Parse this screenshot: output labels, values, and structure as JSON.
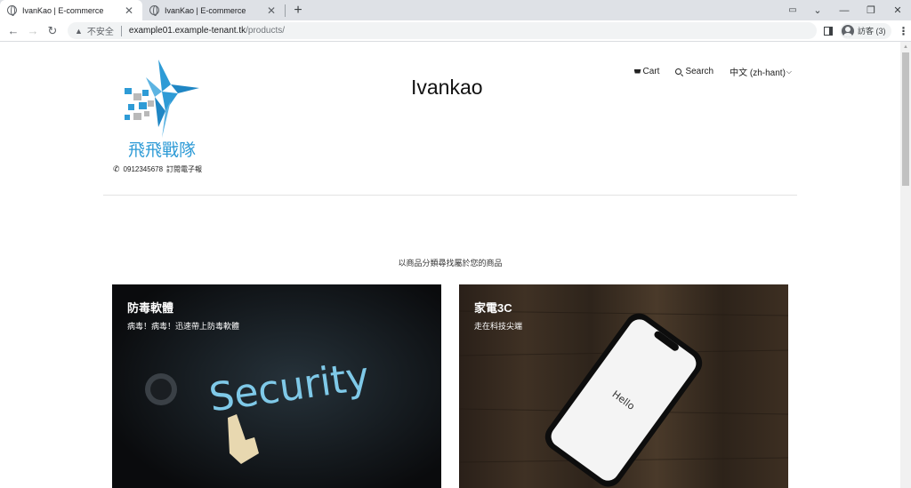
{
  "browser": {
    "tabs": [
      {
        "title": "IvanKao | E-commerce",
        "active": true
      },
      {
        "title": "IvanKao | E-commerce",
        "active": false
      }
    ],
    "address": {
      "security_label": "不安全",
      "host": "example01.example-tenant.tk",
      "path": "/products/"
    },
    "profile_label": "訪客 (3)"
  },
  "site": {
    "brand_name": "Ivankao",
    "logo_text": "飛飛戰隊",
    "phone": "0912345678",
    "subscribe_label": "訂閱電子報",
    "nav": {
      "cart": "Cart",
      "search": "Search",
      "language": "中文 (zh-hant)"
    }
  },
  "catalog": {
    "intro": "以商品分類尋找屬於您的商品",
    "categories": [
      {
        "name": "防毒軟體",
        "description": "病毒！病毒！迅速帶上防毒軟體",
        "image_text": "Security"
      },
      {
        "name": "家電3C",
        "description": "走在科技尖端",
        "image_text": "Hello"
      }
    ]
  },
  "colors": {
    "logo_blue": "#2e9bd6",
    "logo_gray": "#b9b9b9",
    "security_cyan": "#7fc9e8"
  }
}
